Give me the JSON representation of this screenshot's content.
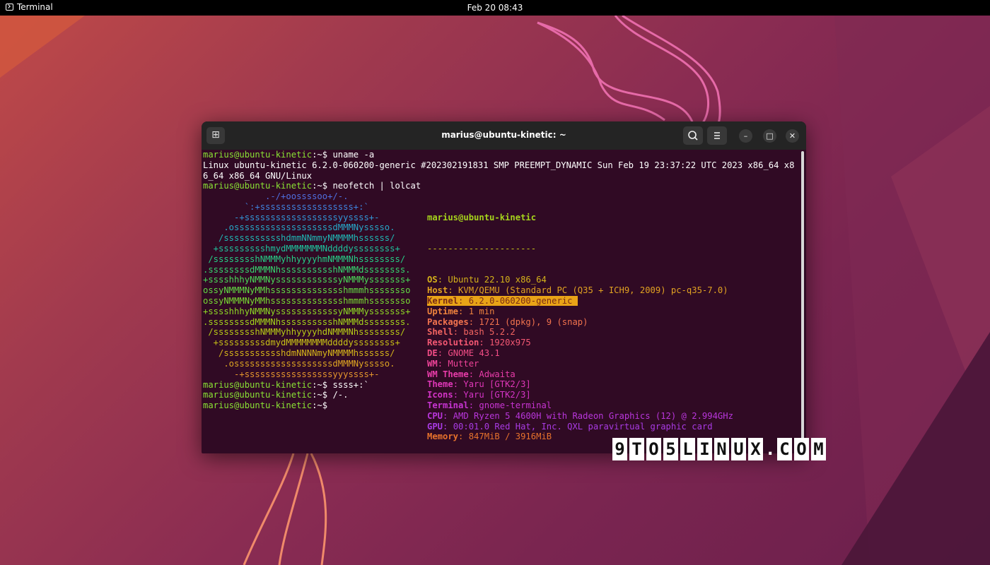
{
  "topbar": {
    "app_name": "Terminal",
    "clock": "Feb 20  08:43"
  },
  "window": {
    "title": "marius@ubuntu-kinetic: ~",
    "new_tab_glyph": "⊞",
    "search_glyph": "⌕",
    "menu_glyph": "≡",
    "minimize_glyph": "–",
    "maximize_glyph": "□",
    "close_glyph": "✕"
  },
  "terminal": {
    "prompt_user": "marius@ubuntu-kinetic",
    "prompt_sep": ":~$ ",
    "cmd1": "uname -a",
    "out1": "Linux ubuntu-kinetic 6.2.0-060200-generic #202302191831 SMP PREEMPT_DYNAMIC Sun Feb 19 23:37:22 UTC 2023 x86_64 x8",
    "out2": "6_64 x86_64 GNU/Linux",
    "cmd2": "neofetch | lolcat",
    "logo_lines": [
      {
        "text": "            .-/+oossssoo+/-.",
        "color": "#4f6fe0"
      },
      {
        "text": "        `:+ssssssssssssssssss+:`",
        "color": "#3f84e0"
      },
      {
        "text": "      -+ssssssssssssssssssyyssss+-",
        "color": "#3296d8"
      },
      {
        "text": "    .osssssssssssssssssssdMMMNysssso.",
        "color": "#26a7c8"
      },
      {
        "text": "   /ssssssssssshdmmNNmmyNMMMMhssssss/",
        "color": "#1fb6b4"
      },
      {
        "text": "  +ssssssssshmydMMMMMMMNddddyssssssss+",
        "color": "#1ec39d"
      },
      {
        "text": " /sssssssshNMMMyhhyyyyhmNMMMNhssssssss/",
        "color": "#26cd86"
      },
      {
        "text": ".ssssssssdMMMNhsssssssssshNMMMdssssssss.",
        "color": "#36d56f"
      },
      {
        "text": "+sssshhhyNMMNyssssssssssssyNMMMysssssss+",
        "color": "#4ada58"
      },
      {
        "text": "ossyNMMMNyMMhsssssssssssssshmmmhssssssso",
        "color": "#62dc44"
      },
      {
        "text": "ossyNMMMNyMMhsssssssssssssshmmmhssssssso",
        "color": "#79dc33"
      },
      {
        "text": "+sssshhhyNMMNyssssssssssssyNMMMysssssss+",
        "color": "#8fd925"
      },
      {
        "text": ".ssssssssdMMMNhsssssssssshNMMMdssssssss.",
        "color": "#a4d31b"
      },
      {
        "text": " /sssssssshNMMMyhhyyyyhdNMMMNhssssssss/",
        "color": "#b7cb16"
      },
      {
        "text": "  +sssssssssdmydMMMMMMMMddddyssssssss+",
        "color": "#c7c016"
      },
      {
        "text": "   /ssssssssssshdmNNNNmyNMMMMhssssss/",
        "color": "#d4b31a"
      },
      {
        "text": "    .osssssssssssssssssssdMMMNysssso.",
        "color": "#dea522"
      },
      {
        "text": "      -+sssssssssssssssssyyyssss+-",
        "color": "#e5962d"
      }
    ],
    "info_header": "marius@ubuntu-kinetic",
    "info_header_color": "#a5d31c",
    "info_sep": "---------------------",
    "info_sep_color": "#c4c219",
    "info_lines": [
      {
        "label": "OS",
        "value": "Ubuntu 22.10 x86_64",
        "color": "#d5b21a"
      },
      {
        "label": "Host",
        "value": "KVM/QEMU (Standard PC (Q35 + ICH9, 2009) pc-q35-7.0)",
        "color": "#e1a222"
      },
      {
        "label": "Kernel",
        "value": "6.2.0-060200-generic",
        "color": "#e8922e",
        "highlight": true
      },
      {
        "label": "Uptime",
        "value": "1 min",
        "color": "#ee823d"
      },
      {
        "label": "Packages",
        "value": "1721 (dpkg), 9 (snap)",
        "color": "#f2734e"
      },
      {
        "label": "Shell",
        "value": "bash 5.2.2",
        "color": "#f46561"
      },
      {
        "label": "Resolution",
        "value": "1920x975",
        "color": "#f45873"
      },
      {
        "label": "DE",
        "value": "GNOME 43.1",
        "color": "#f24d86"
      },
      {
        "label": "WM",
        "value": "Mutter",
        "color": "#ee4398"
      },
      {
        "label": "WM Theme",
        "value": "Adwaita",
        "color": "#e83ca9"
      },
      {
        "label": "Theme",
        "value": "Yaru [GTK2/3]",
        "color": "#df37b8"
      },
      {
        "label": "Icons",
        "value": "Yaru [GTK2/3]",
        "color": "#d434c6"
      },
      {
        "label": "Terminal",
        "value": "gnome-terminal",
        "color": "#c734d2"
      },
      {
        "label": "CPU",
        "value": "AMD Ryzen 5 4600H with Radeon Graphics (12) @ 2.994GHz",
        "color": "#b936dc"
      },
      {
        "label": "GPU",
        "value": "00:01.0 Red Hat, Inc. QXL paravirtual graphic card",
        "color": "#a93be4"
      },
      {
        "label": "Memory",
        "value": "847MiB / 3916MiB",
        "color": "#e6722c"
      }
    ],
    "tail1": "ssss+:`",
    "tail2": "/-.",
    "tail3": ""
  },
  "watermark": [
    "9",
    "T",
    "O",
    "5",
    "L",
    "I",
    "N",
    "U",
    "X",
    ".",
    "C",
    "O",
    "M"
  ]
}
